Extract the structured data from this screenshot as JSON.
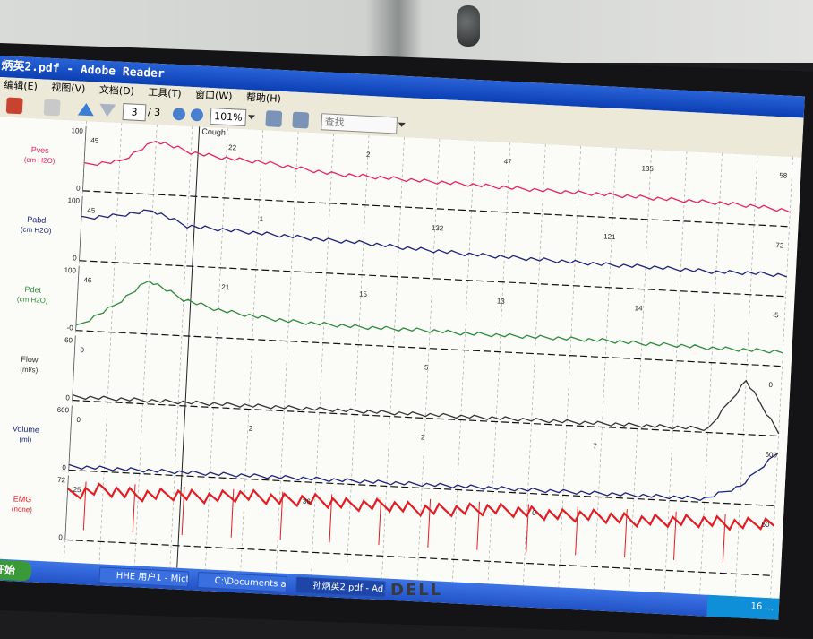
{
  "window": {
    "title": "炳英2.pdf - Adobe Reader"
  },
  "menu": [
    "编辑(E)",
    "视图(V)",
    "文档(D)",
    "工具(T)",
    "窗口(W)",
    "帮助(H)"
  ],
  "toolbar": {
    "page_current": "3",
    "page_total": "/ 3",
    "zoom": "101%",
    "search_placeholder": "查找"
  },
  "chart_data": {
    "type": "line",
    "annotations": [
      "Cough"
    ],
    "channels": [
      {
        "name": "Pves",
        "unit": "(cm H2O)",
        "scale_top": "100",
        "scale_bottom": "0",
        "color": "#e8245a",
        "values": [
          45,
          55,
          100,
          80,
          72,
          68,
          60,
          52,
          50,
          48,
          46,
          44,
          42,
          40,
          39,
          38,
          36,
          34,
          33,
          30,
          24
        ],
        "labels": [
          "45",
          "22",
          "2",
          "47",
          "135",
          "58"
        ]
      },
      {
        "name": "Pabd",
        "unit": "(cm H2O)",
        "scale_top": "100",
        "scale_bottom": "0",
        "color": "#1a237e",
        "values": [
          45,
          50,
          58,
          42,
          40,
          38,
          36,
          34,
          33,
          30,
          28,
          26,
          25,
          24,
          23,
          22,
          22,
          21,
          20,
          21,
          20
        ],
        "labels": [
          "45",
          "1",
          "132",
          "121",
          "72"
        ]
      },
      {
        "name": "Pdet",
        "unit": "(cm H2O)",
        "scale_top": "100",
        "scale_bottom": "-0",
        "color": "#2e8b3a",
        "values": [
          0,
          20,
          46,
          30,
          22,
          18,
          15,
          14,
          13,
          13,
          13,
          12,
          12,
          12,
          12,
          12,
          11,
          11,
          10,
          10,
          10
        ],
        "labels": [
          "46",
          "21",
          "15",
          "13",
          "14",
          "-5"
        ]
      },
      {
        "name": "Flow",
        "unit": "(ml/s)",
        "scale_top": "60",
        "scale_bottom": "0",
        "color": "#333333",
        "values": [
          0,
          0,
          0,
          0,
          0,
          0,
          0,
          0,
          0,
          0,
          0,
          0,
          0,
          0,
          0,
          0,
          0,
          0,
          0,
          5,
          0
        ],
        "labels": [
          "0",
          "5",
          "0"
        ]
      },
      {
        "name": "Volume",
        "unit": "(ml)",
        "scale_top": "600",
        "scale_bottom": "0",
        "color": "#1a237e",
        "values": [
          0,
          0,
          0,
          0,
          0,
          0,
          0,
          0,
          0,
          0,
          0,
          0,
          0,
          0,
          0,
          0,
          0,
          0,
          0,
          2,
          7
        ],
        "labels": [
          "0",
          "2",
          "2",
          "7",
          "600"
        ]
      },
      {
        "name": "EMG",
        "unit": "(none)",
        "scale_top": "72",
        "scale_bottom": "0",
        "color": "#e31b23",
        "values": [
          30,
          35,
          32,
          34,
          33,
          36,
          34,
          35,
          33,
          34,
          32,
          33,
          35,
          34,
          33,
          34,
          32,
          33,
          34,
          33,
          36
        ],
        "labels": [
          "25",
          "36",
          "0",
          "50"
        ]
      }
    ]
  },
  "taskbar": {
    "start": "开始",
    "tasks": [
      "HHE 用户1 - Mict...",
      "C:\\Documents and...",
      "孙炳英2.pdf - Ad..."
    ],
    "clock": "16 ..."
  },
  "monitor": {
    "brand": "DELL"
  }
}
